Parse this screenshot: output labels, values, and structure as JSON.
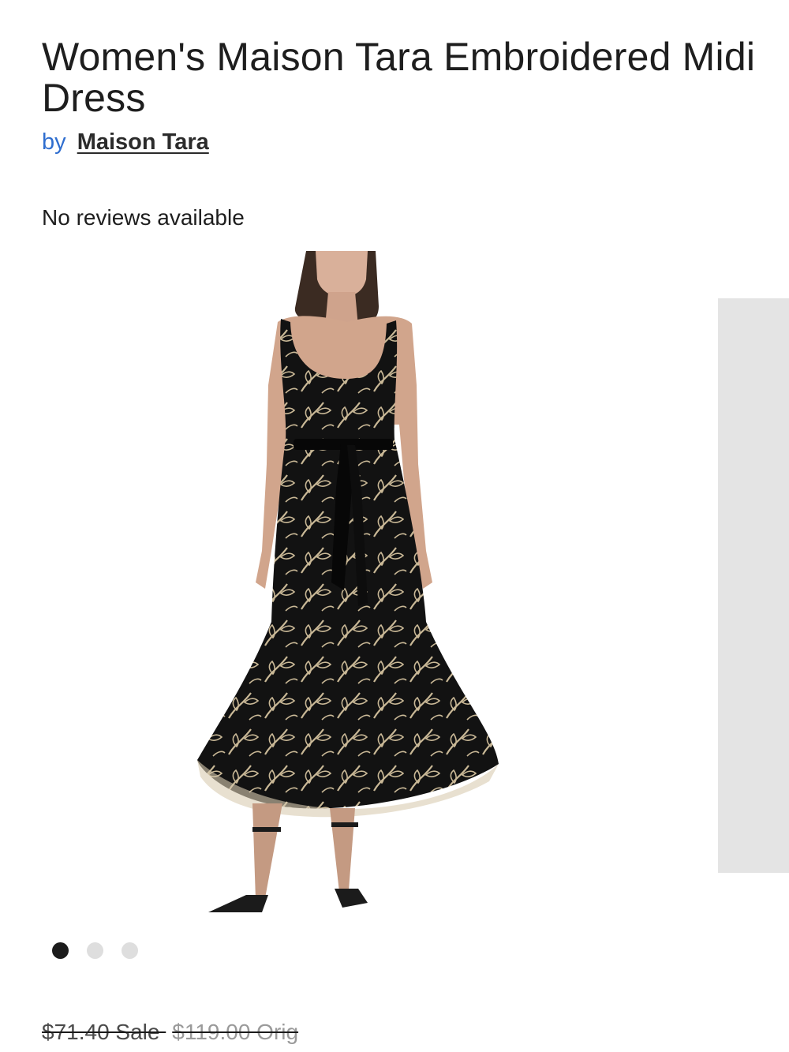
{
  "product": {
    "title": "Women's Maison Tara Embroidered Midi Dress",
    "by_label": "by",
    "brand": "Maison Tara"
  },
  "reviews": {
    "text": "No reviews available"
  },
  "gallery": {
    "slide_count": 3,
    "active_index": 0
  },
  "pricing": {
    "sale_price": "$71.40 Sale",
    "original_price": "$119.00 Orig"
  },
  "colors": {
    "link_blue": "#2f6ecf",
    "dress_black": "#121212",
    "embroidery_gold": "#c9b896",
    "dot_active": "#1c1c1c",
    "dot_inactive": "#dedede"
  }
}
